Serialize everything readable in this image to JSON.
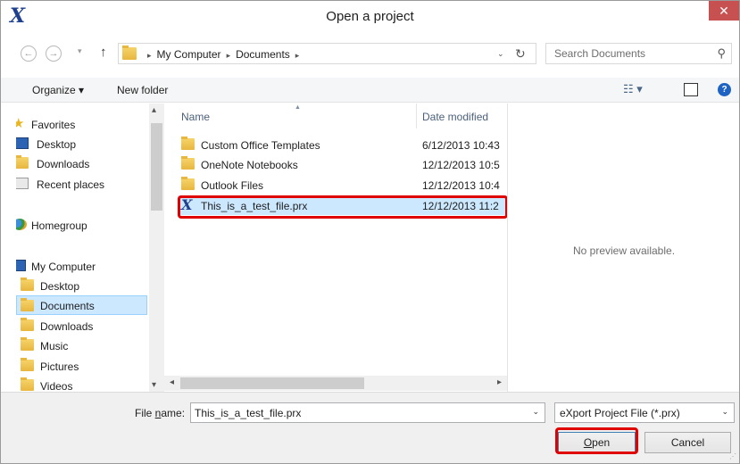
{
  "window": {
    "title": "Open a project",
    "close_glyph": "✕",
    "app_icon_glyph": "X"
  },
  "navigation": {
    "back_glyph": "←",
    "forward_glyph": "→",
    "recent_glyph": "▾",
    "up_glyph": "↑",
    "breadcrumbs": [
      "My Computer",
      "Documents"
    ],
    "crumb_separator": "▸",
    "dropdown_glyph": "⌄",
    "refresh_glyph": "↻"
  },
  "search": {
    "placeholder": "Search Documents",
    "icon_glyph": "⚲"
  },
  "toolbar": {
    "organize_label": "Organize ▾",
    "new_folder_label": "New folder",
    "views_glyph": "☷ ▾",
    "help_glyph": "?"
  },
  "sidebar": {
    "favorites": "Favorites",
    "desktop": "Desktop",
    "downloads": "Downloads",
    "recent_places": "Recent places",
    "homegroup": "Homegroup",
    "my_computer": "My Computer",
    "mc_desktop": "Desktop",
    "mc_documents": "Documents",
    "mc_downloads": "Downloads",
    "mc_music": "Music",
    "mc_pictures": "Pictures",
    "mc_videos": "Videos",
    "star_glyph": "★",
    "scroll_up_glyph": "▴",
    "scroll_down_glyph": "▾"
  },
  "filelist": {
    "columns": {
      "name": "Name",
      "date": "Date modified"
    },
    "sort_glyph": "▲",
    "files": [
      {
        "name": "Custom Office Templates",
        "date": "6/12/2013 10:43"
      },
      {
        "name": "OneNote Notebooks",
        "date": "12/12/2013 10:5"
      },
      {
        "name": "Outlook Files",
        "date": "12/12/2013 10:4"
      },
      {
        "name": "This_is_a_test_file.prx",
        "date": "12/12/2013 11:2"
      }
    ],
    "scroll_left_glyph": "◂",
    "scroll_right_glyph": "▸"
  },
  "preview": {
    "message": "No preview available."
  },
  "footer": {
    "file_name_label_pre": "File ",
    "file_name_label_u": "n",
    "file_name_label_post": "ame:",
    "file_name_value": "This_is_a_test_file.prx",
    "file_type_value": "eXport Project File (*.prx)",
    "dropdown_glyph": "⌄",
    "open_label_u": "O",
    "open_label_rest": "pen",
    "cancel_label": "Cancel",
    "grip_glyph": "⋰"
  },
  "colors": {
    "highlight_red": "#e00000",
    "selection_blue": "#cce8ff",
    "close_red": "#c75050",
    "app_icon_blue": "#1f3f8f"
  }
}
